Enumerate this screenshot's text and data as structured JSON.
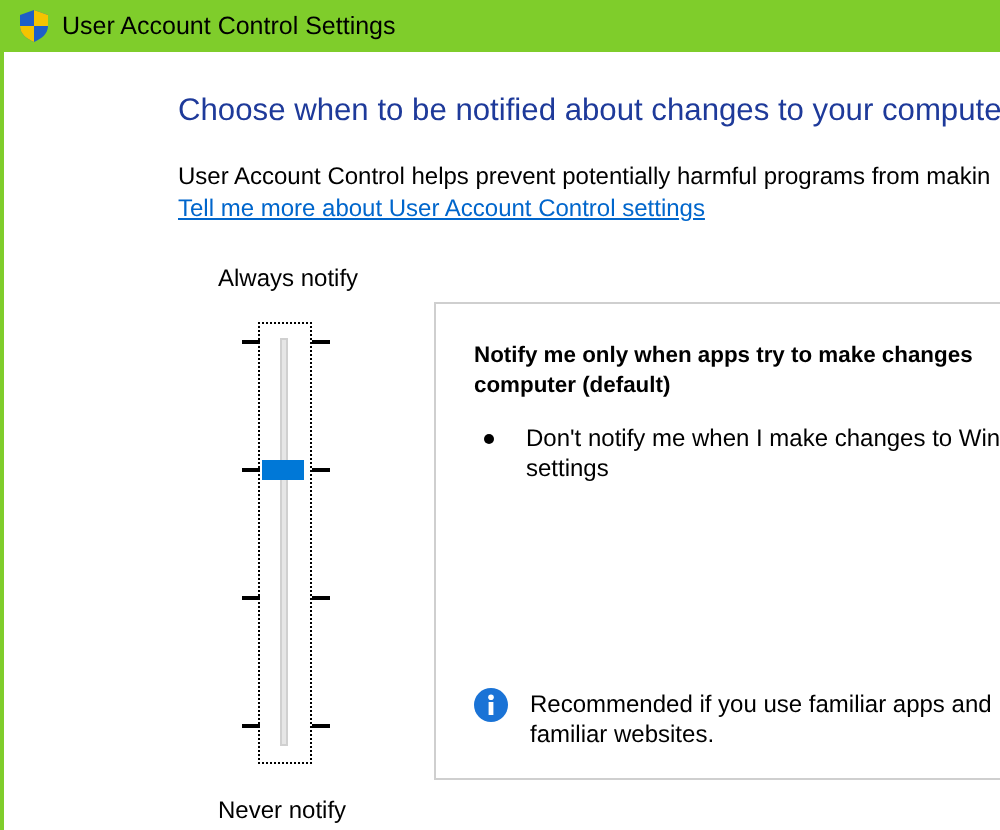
{
  "window": {
    "title": "User Account Control Settings"
  },
  "heading": "Choose when to be notified about changes to your compute",
  "description": "User Account Control helps prevent potentially harmful programs from makin",
  "link": "Tell me more about User Account Control settings",
  "slider": {
    "top_label": "Always notify",
    "bottom_label": "Never notify",
    "level": 0.6667
  },
  "panel": {
    "title_lines": [
      "Notify me only when apps try to make changes",
      "computer (default)"
    ],
    "bullets": [
      {
        "lines": [
          "Don't notify me when I make changes to Win",
          "settings"
        ]
      }
    ],
    "note_lines": [
      "Recommended if you use familiar apps and",
      "familiar websites."
    ]
  }
}
